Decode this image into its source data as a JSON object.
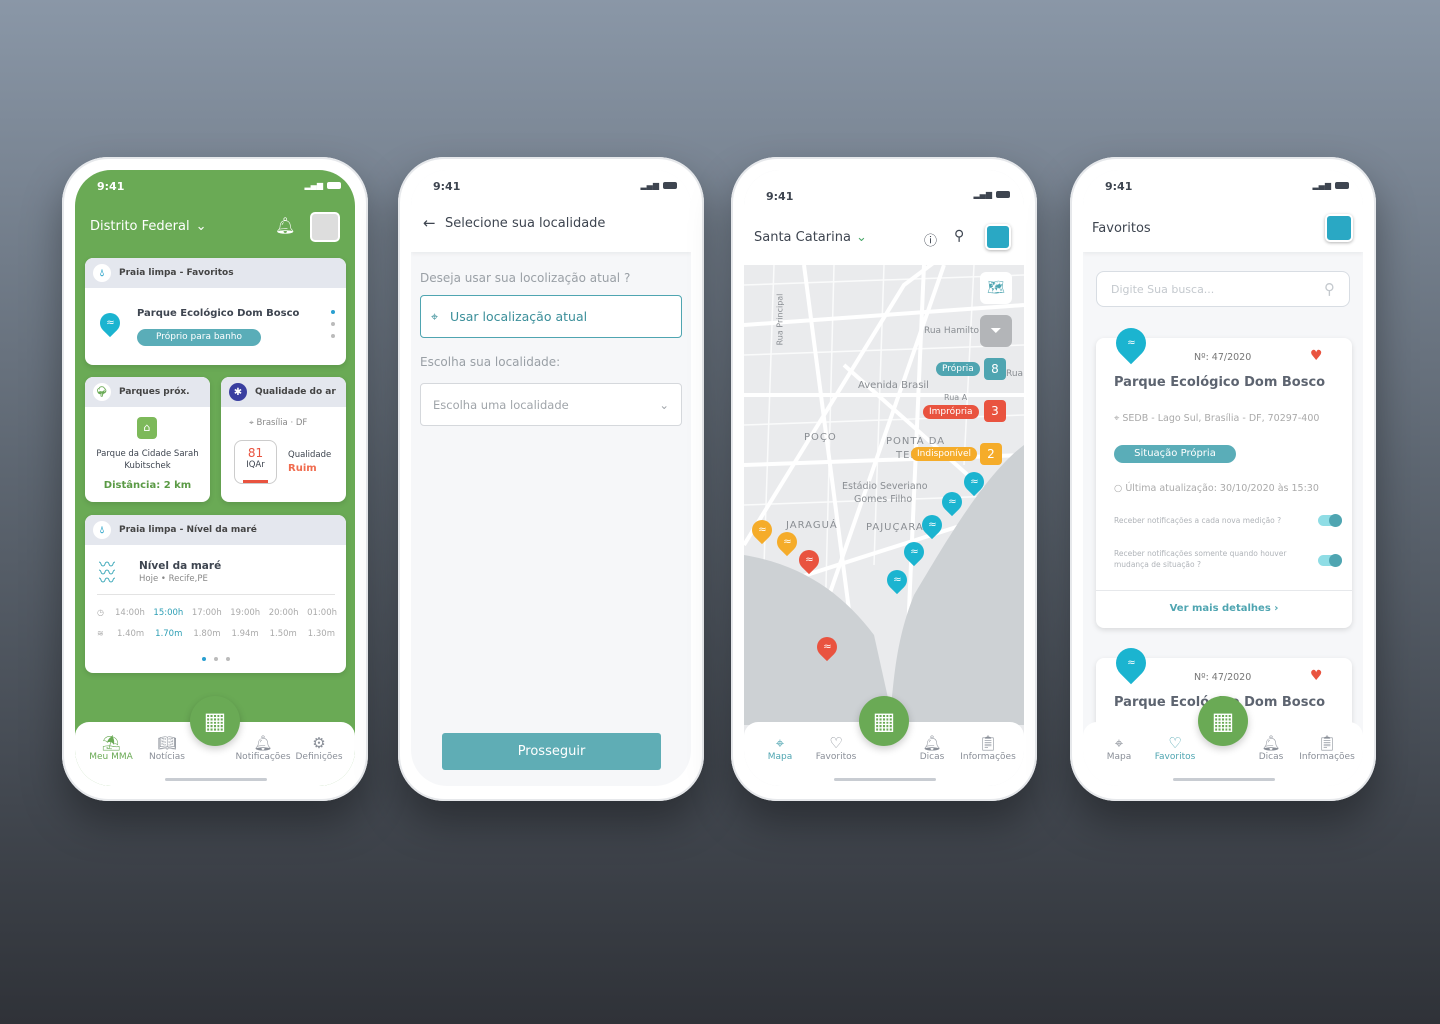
{
  "status_time": "9:41",
  "phone1": {
    "region": "Distrito Federal",
    "card1": {
      "header": "Praia limpa - Favoritos",
      "place": "Parque Ecológico Dom Bosco",
      "badge": "Próprio para banho"
    },
    "card2": {
      "header": "Parques próx.",
      "place": "Parque da Cidade Sarah Kubitschek",
      "distance": "Distância: 2 km"
    },
    "card3": {
      "header": "Qualidade do ar",
      "location": "Brasília · DF",
      "value": "81",
      "unit": "IQAr",
      "quality_label": "Qualidade",
      "quality": "Ruim"
    },
    "card4": {
      "header": "Praia limpa - Nível da maré",
      "title": "Nível da maré",
      "subtitle": "Hoje • Recife,PE",
      "times": [
        "14:00h",
        "15:00h",
        "17:00h",
        "19:00h",
        "20:00h",
        "01:00h"
      ],
      "levels": [
        "1.40m",
        "1.70m",
        "1.80m",
        "1.94m",
        "1.50m",
        "1.30m"
      ],
      "highlight_index": 1
    },
    "nav": [
      {
        "label": "Meu MMA",
        "icon": "island-icon",
        "active": true
      },
      {
        "label": "Notícias",
        "icon": "book-icon"
      },
      {
        "label": "Notificações",
        "icon": "bell-icon"
      },
      {
        "label": "Definições",
        "icon": "gear-icon"
      }
    ]
  },
  "phone2": {
    "title": "Selecione sua localidade",
    "question": "Deseja usar sua locolização atual ?",
    "use_location": "Usar localização atual",
    "choose_label": "Escolha sua localidade:",
    "select_placeholder": "Escolha uma localidade",
    "proceed": "Prosseguir"
  },
  "phone3": {
    "region": "Santa Catarina",
    "map_labels": {
      "street1": "Rua Principal",
      "street2": "Rua Hamilto",
      "street3": "Avenida Brasil",
      "street4": "Rua A",
      "street5": "Rua",
      "d1": "POÇO",
      "d2": "PONTA DA",
      "d3": "TERRA",
      "d4": "Estádio Severiano",
      "d5": "Gomes Filho",
      "d6": "JARAGUÁ",
      "d7": "PAJUÇARA"
    },
    "legend": [
      {
        "label": "Própria",
        "count": "8",
        "color": "#4fa5b1"
      },
      {
        "label": "Imprópria",
        "count": "3",
        "color": "#e9533f"
      },
      {
        "label": "Indisponível",
        "count": "2",
        "color": "#f5ac2a"
      }
    ],
    "nav": [
      {
        "label": "Mapa",
        "icon": "map-pin-icon",
        "active": true
      },
      {
        "label": "Favoritos",
        "icon": "heart-icon"
      },
      {
        "label": "Dicas",
        "icon": "bell-icon"
      },
      {
        "label": "Informações",
        "icon": "clipboard-icon"
      }
    ]
  },
  "phone4": {
    "title": "Favoritos",
    "search_placeholder": "Digite Sua busca...",
    "card": {
      "number": "Nº: 47/2020",
      "name": "Parque Ecológico Dom Bosco",
      "address": "SEDB - Lago Sul, Brasília - DF, 70297-400",
      "status": "Situação Própria",
      "updated": "Última atualização: 30/10/2020 às 15:30",
      "notify1": "Receber notificações a cada nova medição ?",
      "notify2": "Receber notificações somente quando houver mudança de situação ?",
      "notify1_on": true,
      "notify2_on": true,
      "details": "Ver mais detalhes"
    },
    "card2": {
      "number": "Nº: 47/2020",
      "name": "Parque Ecológico Dom Bosco"
    },
    "nav": [
      {
        "label": "Mapa",
        "icon": "map-pin-icon"
      },
      {
        "label": "Favoritos",
        "icon": "heart-icon",
        "active": true
      },
      {
        "label": "Dicas",
        "icon": "bell-icon"
      },
      {
        "label": "Informações",
        "icon": "clipboard-icon"
      }
    ]
  },
  "colors": {
    "green": "#6aaa55",
    "teal": "#4fa5b1",
    "red": "#e9533f",
    "orange": "#f5ac2a"
  }
}
